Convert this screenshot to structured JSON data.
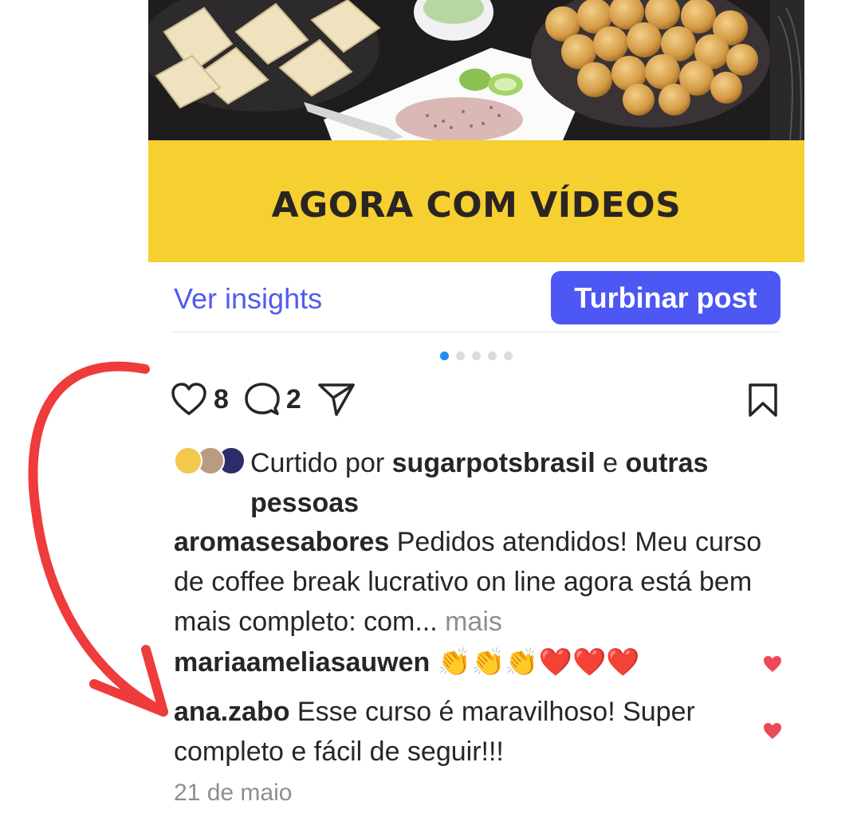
{
  "post": {
    "banner_text": "AGORA COM VÍDEOS",
    "insights_label": "Ver insights",
    "boost_label": "Turbinar post",
    "carousel": {
      "total": 5,
      "active": 1
    }
  },
  "actions": {
    "likes_count": "8",
    "comments_count": "2"
  },
  "likes": {
    "prefix": "Curtido por ",
    "user": "sugarpotsbrasil",
    "conjunction": " e ",
    "others": "outras pessoas"
  },
  "caption": {
    "username": "aromasesabores",
    "text": " Pedidos atendidos! Meu curso de coffee break lucrativo on line agora está bem mais completo: com...",
    "more_label": " mais"
  },
  "comments": [
    {
      "username": "mariaameliasauwen",
      "text": " 👏👏👏❤️❤️❤️"
    },
    {
      "username": "ana.zabo",
      "text": " Esse curso é maravilhoso! Super completo e fácil de seguir!!!"
    }
  ],
  "timestamp": "21 de maio",
  "colors": {
    "link_blue": "#4f5bf0",
    "button_blue": "#4c57f4",
    "banner_yellow": "#f6cf30",
    "active_dot": "#1d8ff3",
    "heart_red": "#ed4956",
    "annotation_red": "#ee3b3b"
  },
  "icons": [
    "heart-icon",
    "comment-icon",
    "share-icon",
    "bookmark-icon",
    "small-heart-icon"
  ]
}
